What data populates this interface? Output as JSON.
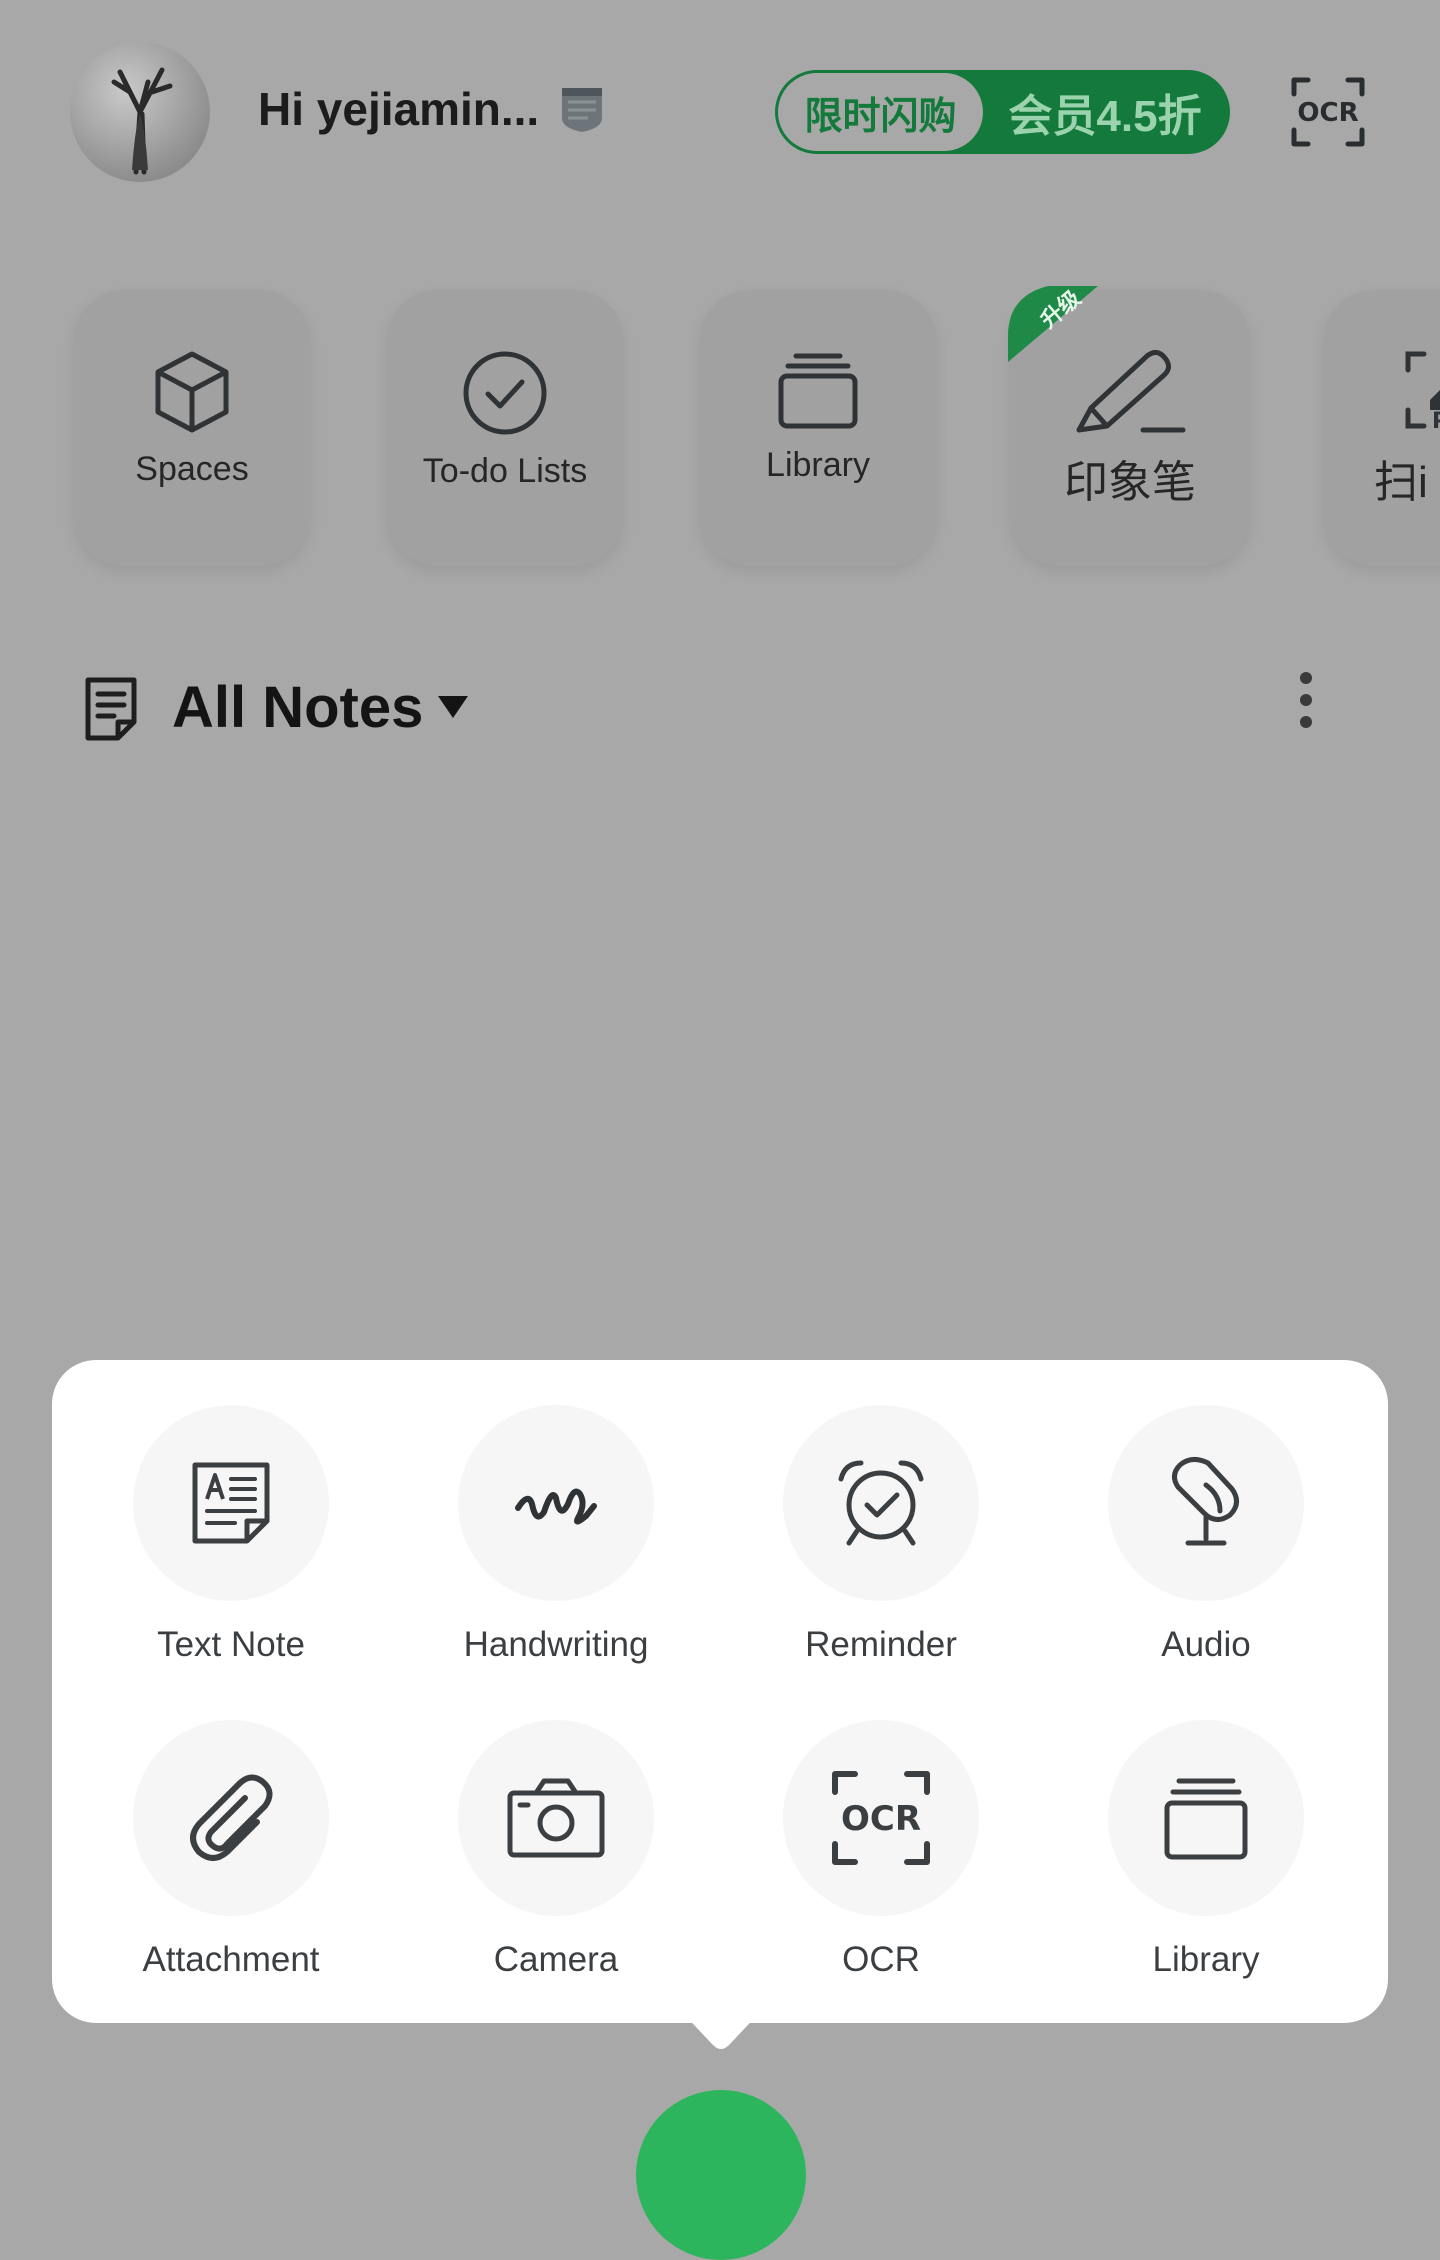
{
  "header": {
    "greeting": "Hi yejiamin...",
    "promo_left": "限时闪购",
    "promo_right": "会员4.5折",
    "ocr_label": "OCR"
  },
  "shortcuts": [
    {
      "label": "Spaces",
      "icon": "cube-icon"
    },
    {
      "label": "To-do Lists",
      "icon": "check-circle-icon"
    },
    {
      "label": "Library",
      "icon": "stack-icon"
    },
    {
      "label": "印象笔",
      "icon": "pen-icon",
      "badge": "升级"
    },
    {
      "label": "扫i",
      "icon": "scan-pdf-icon"
    }
  ],
  "notes": {
    "title": "All Notes"
  },
  "create_menu": {
    "items": [
      {
        "label": "Text Note",
        "icon": "text-note-icon"
      },
      {
        "label": "Handwriting",
        "icon": "handwriting-icon"
      },
      {
        "label": "Reminder",
        "icon": "alarm-clock-icon"
      },
      {
        "label": "Audio",
        "icon": "microphone-icon"
      },
      {
        "label": "Attachment",
        "icon": "paperclip-icon"
      },
      {
        "label": "Camera",
        "icon": "camera-icon"
      },
      {
        "label": "OCR",
        "icon": "ocr-icon"
      },
      {
        "label": "Library",
        "icon": "stack-icon"
      }
    ],
    "ocr_icon_text": "OCR"
  },
  "colors": {
    "brand_green": "#2db55d",
    "promo_green": "#147a3c",
    "overlay_gray": "#a8a8a8",
    "icon_dark": "#3b3f42"
  }
}
